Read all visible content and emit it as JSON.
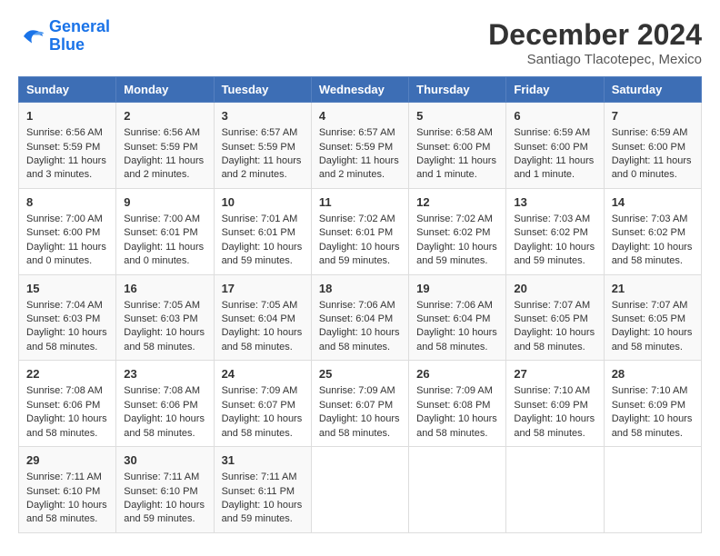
{
  "header": {
    "logo_line1": "General",
    "logo_line2": "Blue",
    "month": "December 2024",
    "location": "Santiago Tlacotepec, Mexico"
  },
  "weekdays": [
    "Sunday",
    "Monday",
    "Tuesday",
    "Wednesday",
    "Thursday",
    "Friday",
    "Saturday"
  ],
  "weeks": [
    [
      {
        "day": "1",
        "sunrise": "6:56 AM",
        "sunset": "5:59 PM",
        "daylight": "11 hours and 3 minutes."
      },
      {
        "day": "2",
        "sunrise": "6:56 AM",
        "sunset": "5:59 PM",
        "daylight": "11 hours and 2 minutes."
      },
      {
        "day": "3",
        "sunrise": "6:57 AM",
        "sunset": "5:59 PM",
        "daylight": "11 hours and 2 minutes."
      },
      {
        "day": "4",
        "sunrise": "6:57 AM",
        "sunset": "5:59 PM",
        "daylight": "11 hours and 2 minutes."
      },
      {
        "day": "5",
        "sunrise": "6:58 AM",
        "sunset": "6:00 PM",
        "daylight": "11 hours and 1 minute."
      },
      {
        "day": "6",
        "sunrise": "6:59 AM",
        "sunset": "6:00 PM",
        "daylight": "11 hours and 1 minute."
      },
      {
        "day": "7",
        "sunrise": "6:59 AM",
        "sunset": "6:00 PM",
        "daylight": "11 hours and 0 minutes."
      }
    ],
    [
      {
        "day": "8",
        "sunrise": "7:00 AM",
        "sunset": "6:00 PM",
        "daylight": "11 hours and 0 minutes."
      },
      {
        "day": "9",
        "sunrise": "7:00 AM",
        "sunset": "6:01 PM",
        "daylight": "11 hours and 0 minutes."
      },
      {
        "day": "10",
        "sunrise": "7:01 AM",
        "sunset": "6:01 PM",
        "daylight": "10 hours and 59 minutes."
      },
      {
        "day": "11",
        "sunrise": "7:02 AM",
        "sunset": "6:01 PM",
        "daylight": "10 hours and 59 minutes."
      },
      {
        "day": "12",
        "sunrise": "7:02 AM",
        "sunset": "6:02 PM",
        "daylight": "10 hours and 59 minutes."
      },
      {
        "day": "13",
        "sunrise": "7:03 AM",
        "sunset": "6:02 PM",
        "daylight": "10 hours and 59 minutes."
      },
      {
        "day": "14",
        "sunrise": "7:03 AM",
        "sunset": "6:02 PM",
        "daylight": "10 hours and 58 minutes."
      }
    ],
    [
      {
        "day": "15",
        "sunrise": "7:04 AM",
        "sunset": "6:03 PM",
        "daylight": "10 hours and 58 minutes."
      },
      {
        "day": "16",
        "sunrise": "7:05 AM",
        "sunset": "6:03 PM",
        "daylight": "10 hours and 58 minutes."
      },
      {
        "day": "17",
        "sunrise": "7:05 AM",
        "sunset": "6:04 PM",
        "daylight": "10 hours and 58 minutes."
      },
      {
        "day": "18",
        "sunrise": "7:06 AM",
        "sunset": "6:04 PM",
        "daylight": "10 hours and 58 minutes."
      },
      {
        "day": "19",
        "sunrise": "7:06 AM",
        "sunset": "6:04 PM",
        "daylight": "10 hours and 58 minutes."
      },
      {
        "day": "20",
        "sunrise": "7:07 AM",
        "sunset": "6:05 PM",
        "daylight": "10 hours and 58 minutes."
      },
      {
        "day": "21",
        "sunrise": "7:07 AM",
        "sunset": "6:05 PM",
        "daylight": "10 hours and 58 minutes."
      }
    ],
    [
      {
        "day": "22",
        "sunrise": "7:08 AM",
        "sunset": "6:06 PM",
        "daylight": "10 hours and 58 minutes."
      },
      {
        "day": "23",
        "sunrise": "7:08 AM",
        "sunset": "6:06 PM",
        "daylight": "10 hours and 58 minutes."
      },
      {
        "day": "24",
        "sunrise": "7:09 AM",
        "sunset": "6:07 PM",
        "daylight": "10 hours and 58 minutes."
      },
      {
        "day": "25",
        "sunrise": "7:09 AM",
        "sunset": "6:07 PM",
        "daylight": "10 hours and 58 minutes."
      },
      {
        "day": "26",
        "sunrise": "7:09 AM",
        "sunset": "6:08 PM",
        "daylight": "10 hours and 58 minutes."
      },
      {
        "day": "27",
        "sunrise": "7:10 AM",
        "sunset": "6:09 PM",
        "daylight": "10 hours and 58 minutes."
      },
      {
        "day": "28",
        "sunrise": "7:10 AM",
        "sunset": "6:09 PM",
        "daylight": "10 hours and 58 minutes."
      }
    ],
    [
      {
        "day": "29",
        "sunrise": "7:11 AM",
        "sunset": "6:10 PM",
        "daylight": "10 hours and 58 minutes."
      },
      {
        "day": "30",
        "sunrise": "7:11 AM",
        "sunset": "6:10 PM",
        "daylight": "10 hours and 59 minutes."
      },
      {
        "day": "31",
        "sunrise": "7:11 AM",
        "sunset": "6:11 PM",
        "daylight": "10 hours and 59 minutes."
      },
      null,
      null,
      null,
      null
    ]
  ]
}
